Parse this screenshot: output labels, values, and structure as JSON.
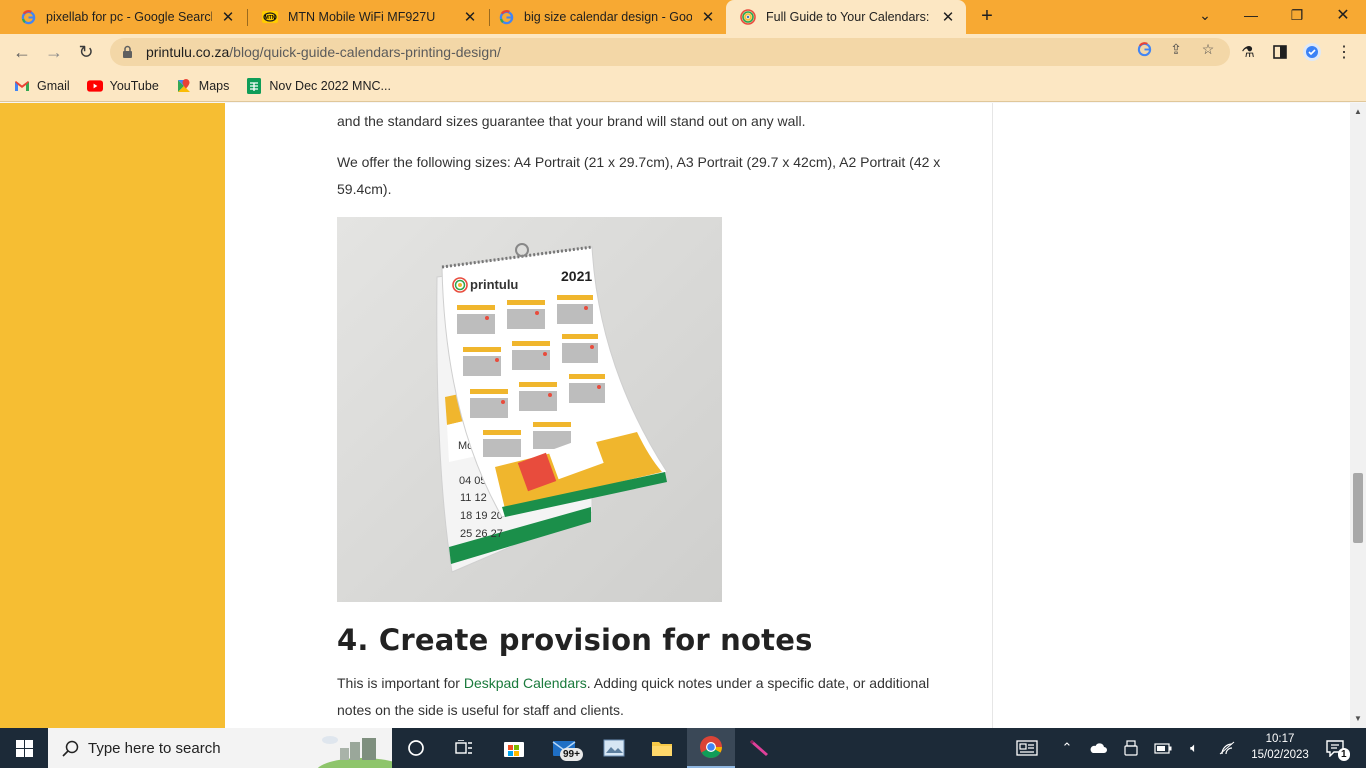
{
  "tabs": [
    {
      "title": "pixellab for pc - Google Search",
      "favicon": "google-icon"
    },
    {
      "title": "MTN Mobile WiFi MF927U",
      "favicon": "mtn-icon"
    },
    {
      "title": "big size calendar design - Google",
      "favicon": "google-icon"
    },
    {
      "title": "Full Guide to Your Calendars: Avo",
      "favicon": "printulu-icon"
    }
  ],
  "address_bar": {
    "domain": "printulu.co.za",
    "path": "/blog/quick-guide-calendars-printing-design/"
  },
  "bookmarks": [
    {
      "label": "Gmail",
      "icon": "gmail-icon"
    },
    {
      "label": "YouTube",
      "icon": "youtube-icon"
    },
    {
      "label": "Maps",
      "icon": "maps-icon"
    },
    {
      "label": "Nov Dec 2022 MNC...",
      "icon": "sheets-icon"
    }
  ],
  "article": {
    "para1": "and the standard sizes guarantee that your brand will stand out on any wall.",
    "para2": "We offer the following sizes: A4 Portrait (21 x 29.7cm), A3 Portrait (29.7 x 42cm), A2 Portrait (42 x 59.4cm).",
    "image_brand": "printulu",
    "image_year": "2021",
    "heading": "4. Create provision for notes",
    "para3_before": "This is important for ",
    "para3_link": "Deskpad Calendars",
    "para3_after": ". Adding quick notes under a specific date, or additional notes on the side is useful for staff and clients."
  },
  "taskbar": {
    "search_placeholder": "Type here to search",
    "mail_badge": "99+",
    "time": "10:17",
    "date": "15/02/2023",
    "notifications": "1"
  },
  "colors": {
    "tabstrip": "#f7a933",
    "toolbar": "#fce7c3",
    "leftbar": "#f6be33",
    "link": "#1a7a3c"
  }
}
